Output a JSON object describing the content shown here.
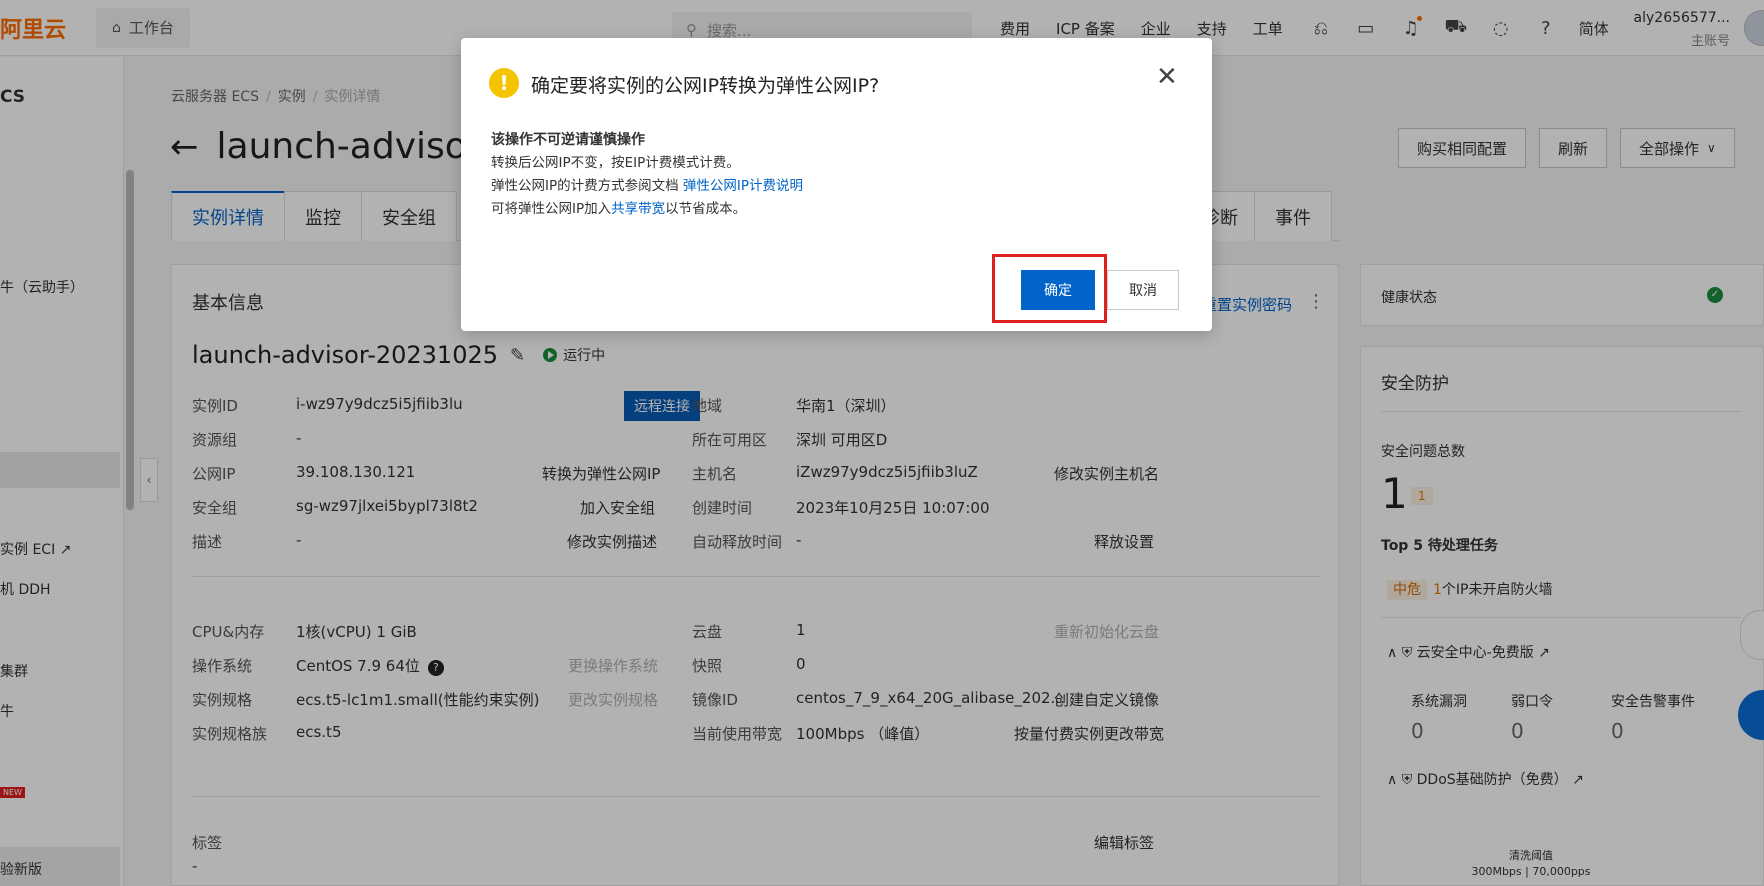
{
  "topbar": {
    "logo": "阿里云",
    "workbench": "工作台",
    "search_placeholder": "搜索...",
    "nav": [
      "费用",
      "ICP 备案",
      "企业",
      "支持",
      "工单"
    ],
    "lang": "简体",
    "user_name": "aly2656577...",
    "user_role": "主账号"
  },
  "sidebar": {
    "heading": "CS",
    "items": [
      {
        "label": "牛（云助手）"
      },
      {
        "label": "实例 ECI ↗"
      },
      {
        "label": "机 DDH"
      },
      {
        "label": "集群"
      },
      {
        "label": "牛"
      },
      {
        "label": "NEW"
      },
      {
        "label": "验新版"
      }
    ]
  },
  "breadcrumb": [
    "云服务器 ECS",
    "实例",
    "实例详情"
  ],
  "page_title": "launch-advisor",
  "actions": {
    "buy_same": "购买相同配置",
    "refresh": "刷新",
    "all_ops": "全部操作"
  },
  "tabs": [
    "实例详情",
    "监控",
    "安全组",
    "诊断",
    "事件"
  ],
  "basic": {
    "title": "基本信息",
    "reset_password": "重置实例密码",
    "instance_name": "launch-advisor-20231025",
    "status": "运行中",
    "remote_connect": "远程连接",
    "left_rows": [
      {
        "label": "实例ID",
        "value": "i-wz97y9dcz5i5jfiib3lu",
        "action": ""
      },
      {
        "label": "资源组",
        "value": "-",
        "action": ""
      },
      {
        "label": "公网IP",
        "value": "39.108.130.121",
        "action": "转换为弹性公网IP"
      },
      {
        "label": "安全组",
        "value": "sg-wz97jlxei5bypl73l8t2",
        "action": "加入安全组"
      },
      {
        "label": "描述",
        "value": "-",
        "action": "修改实例描述"
      }
    ],
    "right_rows": [
      {
        "label": "地域",
        "value": "华南1（深圳）",
        "action": ""
      },
      {
        "label": "所在可用区",
        "value": "深圳 可用区D",
        "action": ""
      },
      {
        "label": "主机名",
        "value": "iZwz97y9dcz5i5jfiib3luZ",
        "action": "修改实例主机名"
      },
      {
        "label": "创建时间",
        "value": "2023年10月25日 10:07:00",
        "action": ""
      },
      {
        "label": "自动释放时间",
        "value": "-",
        "action": "释放设置"
      }
    ],
    "left_rows2": [
      {
        "label": "CPU&内存",
        "value": "1核(vCPU) 1 GiB",
        "action": ""
      },
      {
        "label": "操作系统",
        "value": "CentOS 7.9 64位",
        "action": "更换操作系统"
      },
      {
        "label": "实例规格",
        "value": "ecs.t5-lc1m1.small(性能约束实例)",
        "action": "更改实例规格"
      },
      {
        "label": "实例规格族",
        "value": "ecs.t5",
        "action": ""
      }
    ],
    "right_rows2": [
      {
        "label": "云盘",
        "value": "1",
        "action": "重新初始化云盘"
      },
      {
        "label": "快照",
        "value": "0",
        "action": ""
      },
      {
        "label": "镜像ID",
        "value": "centos_7_9_x64_20G_alibase_202...",
        "action": "创建自定义镜像"
      },
      {
        "label": "当前使用带宽",
        "value": "100Mbps （峰值）",
        "action": "按量付费实例更改带宽"
      }
    ],
    "tags_label": "标签",
    "tags_value": "-",
    "edit_tags": "编辑标签"
  },
  "health": {
    "title": "健康状态"
  },
  "security": {
    "title": "安全防护",
    "total_label": "安全问题总数",
    "total": "1",
    "badge": "1",
    "top5": "Top 5 待处理任务",
    "risk_level": "中危",
    "risk_count": "1",
    "risk_text": "个IP未开启防火墙",
    "group1": "云安全中心-免费版",
    "cols": [
      "系统漏洞",
      "弱口令",
      "安全告警事件"
    ],
    "vals": [
      "0",
      "0",
      "0"
    ],
    "group2": "DDoS基础防护（免费）",
    "wash_label": "清洗阈值",
    "wash_value": "300Mbps | 70,000pps"
  },
  "dialog": {
    "title": "确定要将实例的公网IP转换为弹性公网IP?",
    "line1": "该操作不可逆请谨慎操作",
    "line2": "转换后公网IP不变，按EIP计费模式计费。",
    "line3_prefix": "弹性公网IP的计费方式参阅文档 ",
    "line3_link": "弹性公网IP计费说明",
    "line4_prefix": "可将弹性公网IP加入",
    "line4_link": "共享带宽",
    "line4_suffix": "以节省成本。",
    "ok": "确定",
    "cancel": "取消"
  }
}
